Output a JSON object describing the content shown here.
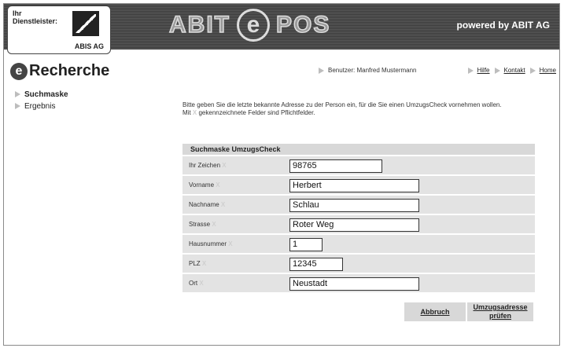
{
  "header": {
    "logo_label": "Ihr Dienstleister:",
    "logo_company": "ABIS AG",
    "brand_left": "ABIT",
    "brand_e": "e",
    "brand_right": "POS",
    "powered_by": "powered by ABIT AG"
  },
  "app": {
    "e_mark": "e",
    "title": "Recherche"
  },
  "user_info": "Benutzer: Manfred Mustermann",
  "top_links": [
    "Hilfe",
    "Kontakt",
    "Home"
  ],
  "sidebar": {
    "items": [
      {
        "label": "Suchmaske",
        "active": true
      },
      {
        "label": "Ergebnis",
        "active": false
      }
    ]
  },
  "intro": {
    "line1": "Bitte geben Sie die letzte bekannte Adresse zu der Person ein, für die Sie einen UmzugsCheck vornehmen wollen.",
    "line2_pre": "Mit",
    "line2_post": "gekennzeichnete Felder sind Pflichtfelder.",
    "required_marker": "X"
  },
  "form": {
    "title": "Suchmaske UmzugsCheck",
    "fields": [
      {
        "label": "Ihr Zeichen",
        "value": "98765"
      },
      {
        "label": "Vorname",
        "value": "Herbert"
      },
      {
        "label": "Nachname",
        "value": "Schlau"
      },
      {
        "label": "Strasse",
        "value": "Roter Weg"
      },
      {
        "label": "Hausnummer",
        "value": "1"
      },
      {
        "label": "PLZ",
        "value": "12345"
      },
      {
        "label": "Ort",
        "value": "Neustadt"
      }
    ]
  },
  "actions": {
    "cancel": "Abbruch",
    "check_line1": "Umzugsadresse",
    "check_line2": "prüfen"
  }
}
